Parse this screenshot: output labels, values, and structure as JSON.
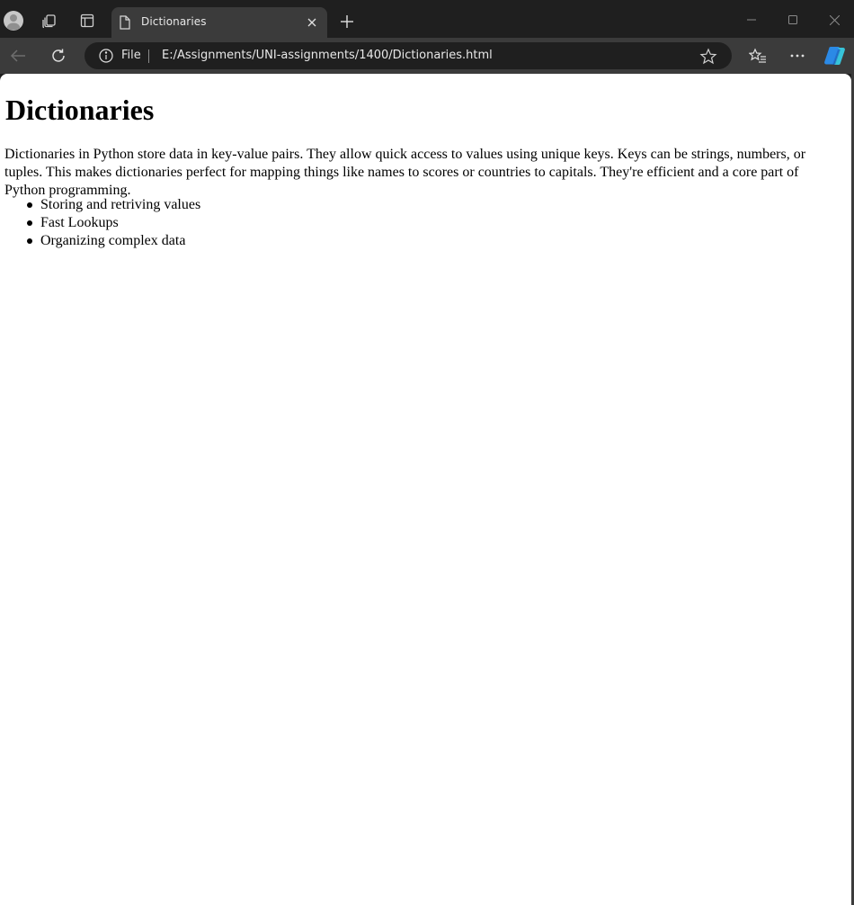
{
  "browser": {
    "tab": {
      "title": "Dictionaries"
    },
    "address_bar": {
      "scheme_label": "File",
      "url": "E:/Assignments/UNI-assignments/1400/Dictionaries.html"
    },
    "icons": {
      "profile": "profile-avatar-icon",
      "workspaces": "workspaces-icon",
      "tab_actions": "tab-actions-icon",
      "page": "page-icon",
      "close_tab": "close-icon",
      "new_tab": "plus-icon",
      "minimize": "minimize-icon",
      "maximize": "maximize-icon",
      "close_window": "close-window-icon",
      "back": "back-arrow-icon",
      "refresh": "refresh-icon",
      "info": "info-icon",
      "favorite": "star-icon",
      "favorites": "favorites-list-icon",
      "more": "more-options-icon",
      "copilot": "copilot-icon"
    },
    "colors": {
      "chrome_dark": "#1f1f1f",
      "chrome_toolbar": "#3b3b3b",
      "page_bg": "#ffffff"
    }
  },
  "page": {
    "heading": "Dictionaries",
    "paragraph": "Dictionaries in Python store data in key-value pairs. They allow quick access to values using unique keys. Keys can be strings, numbers, or tuples. This makes dictionaries perfect for mapping things like names to scores or countries to capitals. They're efficient and a core part of Python programming.",
    "list": [
      "Storing and retriving values",
      "Fast Lookups",
      "Organizing complex data"
    ]
  }
}
